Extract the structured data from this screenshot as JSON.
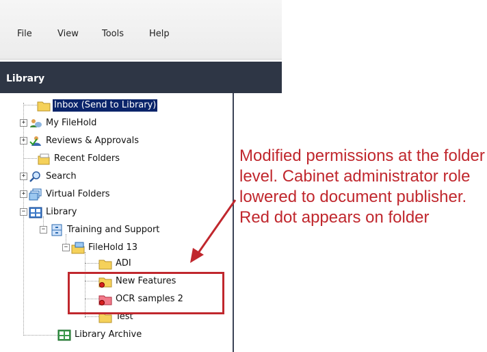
{
  "menu": {
    "items": [
      "File",
      "View",
      "Tools",
      "Help"
    ]
  },
  "panel": {
    "title": "Library"
  },
  "tree": {
    "inbox": "Inbox (Send to Library)",
    "my_filehold": "My FileHold",
    "reviews": "Reviews & Approvals",
    "recent": "Recent Folders",
    "search": "Search",
    "virtual": "Virtual Folders",
    "library": "Library",
    "training": "Training and Support",
    "filehold13": "FileHold 13",
    "adi": "ADI",
    "new_features": "New Features",
    "ocr": "OCR samples 2",
    "test": "Test",
    "archive": "Library Archive"
  },
  "annotation": {
    "text": "Modified permissions at the folder level. Cabinet administrator role lowered to document publisher. Red dot appears on folder"
  },
  "colors": {
    "header_bg": "#2e3645",
    "selection": "#0a246a",
    "annotation_red": "#c0272d",
    "folder_yellow": "#f5d15a"
  }
}
